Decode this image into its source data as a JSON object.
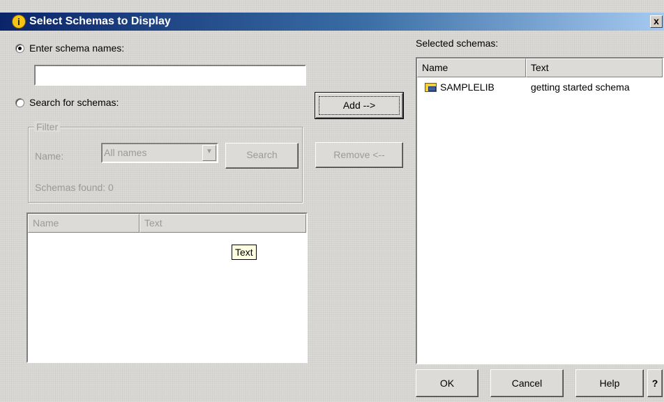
{
  "title": "Select Schemas to Display",
  "title_icon": "info-icon",
  "close_label": "x",
  "left": {
    "radio_enter_label": "Enter schema names:",
    "schema_names_value": "",
    "radio_search_label": "Search for schemas:",
    "filter": {
      "legend": "Filter",
      "name_label": "Name:",
      "name_select_value": "All names",
      "search_button": "Search",
      "found_text": "Schemas found: 0"
    },
    "results_columns": [
      "Name",
      "Text"
    ],
    "tooltip": "Text"
  },
  "middle": {
    "add_button": "Add -->",
    "remove_button": "Remove <--"
  },
  "right": {
    "label": "Selected schemas:",
    "columns": [
      "Name",
      "Text"
    ],
    "rows": [
      {
        "icon": "folder-icon",
        "name": "SAMPLELIB",
        "text": "getting started schema"
      }
    ]
  },
  "buttons": {
    "ok": "OK",
    "cancel": "Cancel",
    "help": "Help",
    "context_help": "?"
  },
  "colors": {
    "title_gradient_start": "#0a246a",
    "title_gradient_end": "#a6caf0",
    "dialog_bg": "#dcdbd7",
    "disabled_text": "#9a9a9a"
  }
}
